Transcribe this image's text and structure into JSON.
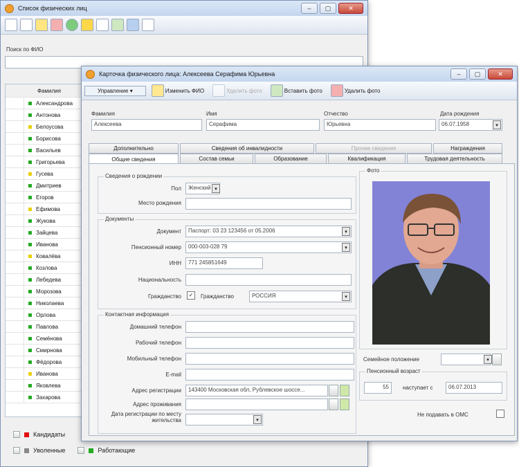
{
  "back_window": {
    "title": "Список физических лиц",
    "search_label": "Поиск по ФИО",
    "column_header": "Фамилия",
    "rows": [
      {
        "name": "Александрова",
        "color": "#22aa22"
      },
      {
        "name": "Антонова",
        "color": "#22aa22"
      },
      {
        "name": "Белоусова",
        "color": "#e8d000"
      },
      {
        "name": "Борисова",
        "color": "#22aa22"
      },
      {
        "name": "Васильев",
        "color": "#22aa22"
      },
      {
        "name": "Григорьева",
        "color": "#22aa22"
      },
      {
        "name": "Гусева",
        "color": "#e8d000"
      },
      {
        "name": "Дмитриев",
        "color": "#22aa22"
      },
      {
        "name": "Егоров",
        "color": "#22aa22"
      },
      {
        "name": "Ефимова",
        "color": "#e8d000"
      },
      {
        "name": "Жукова",
        "color": "#22aa22"
      },
      {
        "name": "Зайцева",
        "color": "#22aa22"
      },
      {
        "name": "Иванова",
        "color": "#22aa22"
      },
      {
        "name": "Ковалёва",
        "color": "#e8d000"
      },
      {
        "name": "Козлова",
        "color": "#22aa22"
      },
      {
        "name": "Лебедева",
        "color": "#22aa22"
      },
      {
        "name": "Морозова",
        "color": "#22aa22"
      },
      {
        "name": "Николаева",
        "color": "#22aa22"
      },
      {
        "name": "Орлова",
        "color": "#22aa22"
      },
      {
        "name": "Павлова",
        "color": "#22aa22"
      },
      {
        "name": "Семёнова",
        "color": "#22aa22"
      },
      {
        "name": "Смирнова",
        "color": "#22aa22"
      },
      {
        "name": "Фёдорова",
        "color": "#22aa22"
      },
      {
        "name": "Иванова",
        "color": "#e8d000"
      },
      {
        "name": "Яковлева",
        "color": "#22aa22"
      },
      {
        "name": "Захарова",
        "color": "#22aa22"
      }
    ],
    "legend": {
      "row1": "Кандидаты",
      "row2a": "Уволенные",
      "row2b": "Работающие"
    }
  },
  "card": {
    "title": "Карточка физического лица: Алексеева Серафима Юрьевна",
    "toolbar": {
      "actions": "Управление",
      "rename": "Изменить ФИО",
      "remove_photo": "Удалить фото",
      "add_photo": "Вставить фото",
      "delete_photo": "Удалить фото"
    },
    "name": {
      "last_label": "Фамилия",
      "last_value": "Алексеева",
      "first_label": "Имя",
      "first_value": "Серафима",
      "middle_label": "Отчество",
      "middle_value": "Юрьевна",
      "birth_label": "Дата рождения",
      "birth_value": "06.07.1958"
    },
    "tabs_top": [
      "Дополнительно",
      "Сведения об инвалидности",
      "Прочие сведения",
      "Награждения"
    ],
    "tabs_bottom": [
      "Общие сведения",
      "Состав семьи",
      "Образование",
      "Квалификация",
      "Трудовая деятельность"
    ],
    "birth_group": {
      "title": "Сведения о рождении",
      "sex_label": "Пол",
      "sex_value": "Женский",
      "place_label": "Место рождения"
    },
    "docs_group": {
      "title": "Документы",
      "doc_label": "Документ",
      "doc_value": "Паспорт: 03 23 123456 от 05.2006",
      "pension_label": "Пенсионный номер",
      "pension_value": "000-003-028 79",
      "inn_label": "ИНН",
      "inn_value": "771 245851649",
      "nationality_label": "Национальность",
      "citizenship_label": "Гражданство",
      "citizen_check": "Гражданство",
      "country_value": "РОССИЯ"
    },
    "contacts_group": {
      "title": "Контактная информация",
      "home_phone": "Домашний телефон",
      "work_phone": "Рабочий телефон",
      "mobile_phone": "Мобильный телефон",
      "email": "E-mail",
      "address_reg": "Адрес регистрации",
      "address_reg_value": "143400 Московская обл, Рублевское шоссе...",
      "address_live": "Адрес проживания",
      "reg_date": "Дата регистрации по месту жительства"
    },
    "photo_label": "Фото",
    "marital_label": "Семейное положение",
    "ret_group_title": "Пенсионный возраст",
    "ret_age_value": "55",
    "ret_date_label": "наступает с",
    "ret_date_value": "06.07.2013",
    "oms_label": "Не подавать в ОМС"
  }
}
